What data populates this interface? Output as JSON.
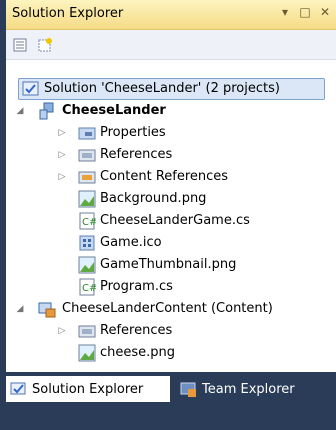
{
  "window": {
    "title": "Solution Explorer",
    "pin_glyph": "▾",
    "restore_glyph": "□",
    "close_glyph": "✕"
  },
  "toolbar": {
    "properties_icon": "properties-icon",
    "show_all_files_icon": "show-all-files-icon"
  },
  "tree": {
    "solution": "Solution 'CheeseLander' (2 projects)",
    "project1": {
      "name": "CheeseLander",
      "items": [
        "Properties",
        "References",
        "Content References",
        "Background.png",
        "CheeseLanderGame.cs",
        "Game.ico",
        "GameThumbnail.png",
        "Program.cs"
      ]
    },
    "project2": {
      "name": "CheeseLanderContent (Content)",
      "items": [
        "References",
        "cheese.png"
      ]
    }
  },
  "tabs": {
    "solution_explorer": "Solution Explorer",
    "team_explorer": "Team Explorer"
  },
  "colors": {
    "title_gradient_top": "#fdf4bf",
    "title_gradient_bottom": "#f5db86",
    "selection": "#dbe7f7",
    "chrome_dark": "#2b3c59"
  }
}
